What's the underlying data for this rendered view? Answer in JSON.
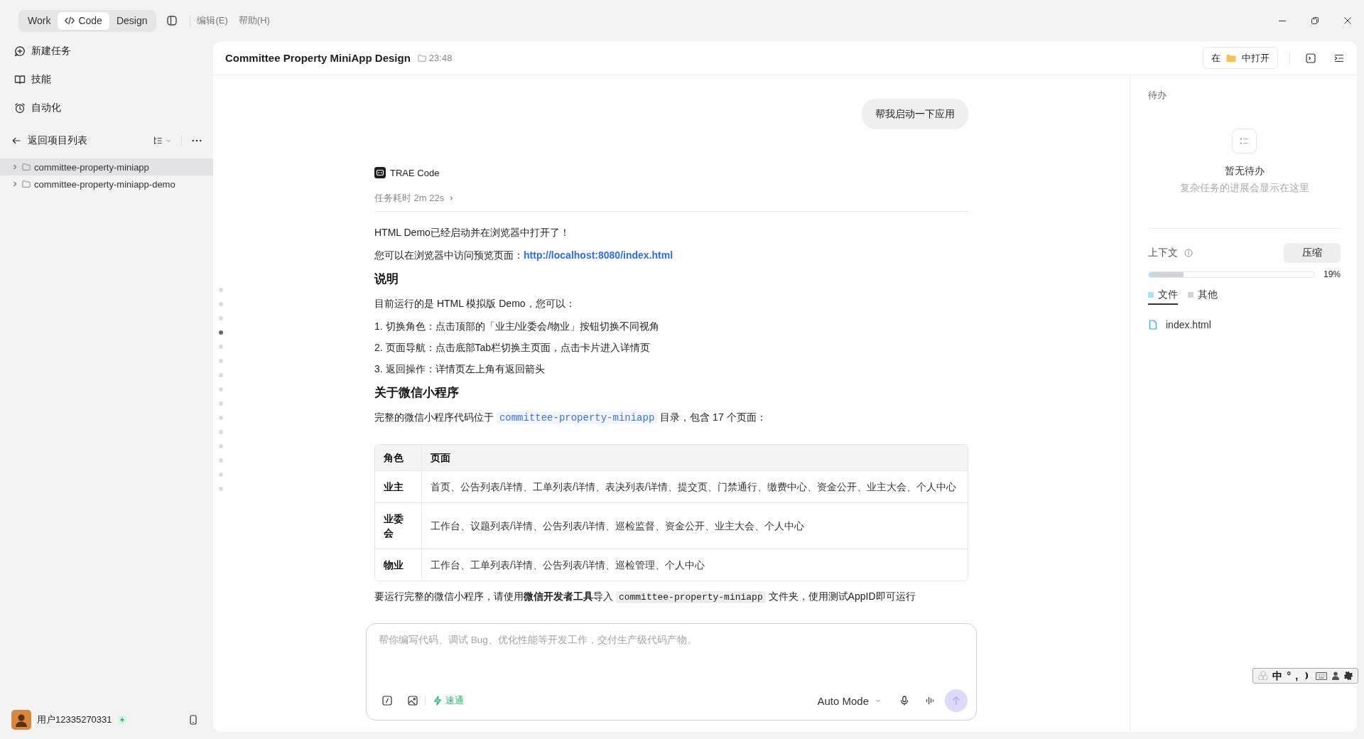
{
  "window": {
    "mode_tabs": [
      {
        "label": "Work",
        "kind": "plain",
        "selected": false
      },
      {
        "label": "Code",
        "kind": "code",
        "selected": true
      },
      {
        "label": "Design",
        "kind": "plain",
        "selected": false
      }
    ],
    "menu": [
      "编辑(E)",
      "帮助(H)"
    ]
  },
  "sidebar": {
    "nav": [
      {
        "label": "新建任务",
        "kind": "new-task"
      },
      {
        "label": "技能",
        "kind": "skills"
      },
      {
        "label": "自动化",
        "kind": "automation"
      }
    ],
    "back_label": "返回项目列表",
    "projects": [
      {
        "name": "committee-property-miniapp",
        "selected": true,
        "expanded": false
      },
      {
        "name": "committee-property-miniapp-demo",
        "selected": false,
        "expanded": false
      }
    ],
    "user": {
      "name": "用户12335270331"
    }
  },
  "header": {
    "title": "Committee Property MiniApp Design",
    "time": "23:48",
    "open_in": {
      "prefix": "在",
      "suffix": "中打开"
    }
  },
  "timeline": [
    {
      "selected": false
    },
    {
      "selected": false
    },
    {
      "selected": false
    },
    {
      "selected": true
    },
    {
      "selected": false
    },
    {
      "selected": false
    },
    {
      "selected": false
    },
    {
      "selected": false
    },
    {
      "selected": false
    },
    {
      "selected": false
    },
    {
      "selected": false
    },
    {
      "selected": false
    },
    {
      "selected": false
    },
    {
      "selected": false
    },
    {
      "selected": false
    }
  ],
  "conversation": {
    "user_message": "帮我启动一下应用",
    "agent_name": "TRAE Code",
    "duration": "任务耗时 2m 22s",
    "blocks": [
      {
        "kind": "paragraph",
        "parts": [
          {
            "kind": "text",
            "text": "HTML Demo已经启动并在浏览器中打开了！"
          }
        ]
      },
      {
        "kind": "paragraph",
        "parts": [
          {
            "kind": "text",
            "text": "您可以在浏览器中访问预览页面："
          },
          {
            "kind": "link",
            "text": "http://localhost:8080/index.html"
          }
        ]
      },
      {
        "kind": "heading",
        "text": "说明"
      },
      {
        "kind": "paragraph",
        "parts": [
          {
            "kind": "text",
            "text": "目前运行的是 HTML 模拟版 Demo，您可以："
          }
        ]
      },
      {
        "kind": "list",
        "items": [
          "1. 切换角色：点击顶部的「业主/业委会/物业」按钮切换不同视角",
          "2. 页面导航：点击底部Tab栏切换主页面，点击卡片进入详情页",
          "3. 返回操作：详情页左上角有返回箭头"
        ]
      },
      {
        "kind": "heading",
        "text": "关于微信小程序"
      },
      {
        "kind": "paragraph",
        "parts": [
          {
            "kind": "text",
            "text": "完整的微信小程序代码位于 "
          },
          {
            "kind": "path",
            "text": "committee-property-miniapp"
          },
          {
            "kind": "text",
            "text": " 目录，包含 17 个页面："
          }
        ]
      },
      {
        "kind": "table",
        "columns": [
          "角色",
          "页面"
        ],
        "rows": [
          [
            "业主",
            "首页、公告列表/详情、工单列表/详情、表决列表/详情、提交页、门禁通行、缴费中心、资金公开、业主大会、个人中心"
          ],
          [
            "业委会",
            "工作台、议题列表/详情、公告列表/详情、巡检监督、资金公开、业主大会、个人中心"
          ],
          [
            "物业",
            "工作台、工单列表/详情、公告列表/详情、巡检管理、个人中心"
          ]
        ]
      },
      {
        "kind": "paragraph",
        "parts": [
          {
            "kind": "text",
            "text": "要运行完整的微信小程序，请使用**微信开发者工具**导入 "
          },
          {
            "kind": "code",
            "text": "committee-property-miniapp"
          },
          {
            "kind": "text",
            "text": " 文件夹，使用测试AppID即可运行"
          }
        ]
      }
    ]
  },
  "composer": {
    "placeholder": "帮你编写代码、调试 Bug、优化性能等开发工作，交付生产级代码产物。",
    "speed_label": "速通",
    "mode": "Auto Mode",
    "send": {
      "disabled": true
    }
  },
  "todo_panel": {
    "title": "待办",
    "empty_title": "暂无待办",
    "empty_hint": "复杂任务的进展会显示在这里"
  },
  "context_panel": {
    "title": "上下文",
    "compress_label": "压缩",
    "usage_bar": [
      {
        "color": "#a8e2f7",
        "level": 0.02
      },
      {
        "color": "#d1d4da",
        "level": 0.19
      }
    ],
    "usage": "19%",
    "categories": [
      {
        "label": "文件",
        "color": "#a8e2f7",
        "selected": true
      },
      {
        "label": "其他",
        "color": "#d1d4da",
        "selected": false
      }
    ],
    "files": [
      "index.html"
    ]
  },
  "ime_toolbar": {
    "items": [
      {
        "kind": "logo"
      },
      {
        "kind": "text",
        "text": "中"
      },
      {
        "kind": "text",
        "text": "°"
      },
      {
        "kind": "text",
        "text": ","
      },
      {
        "kind": "moon"
      },
      {
        "kind": "keyboard"
      },
      {
        "kind": "user"
      },
      {
        "kind": "gear"
      }
    ]
  }
}
